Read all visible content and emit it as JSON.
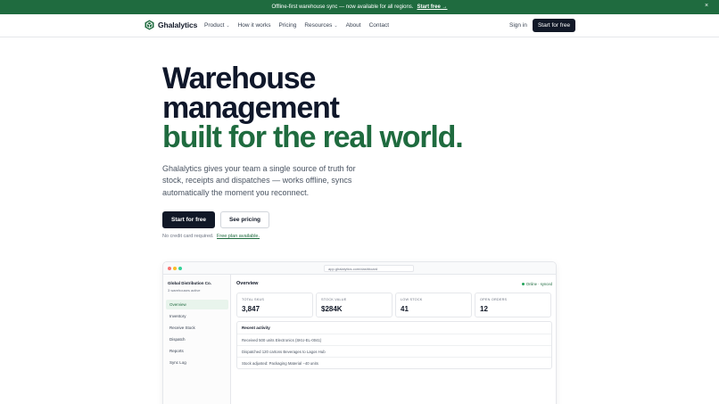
{
  "announcement": {
    "text": "Offline-first warehouse sync — now available for all regions.",
    "cta": "Start free →",
    "close": "×"
  },
  "nav": {
    "brand": "Ghalalytics",
    "links": [
      {
        "label": "Product",
        "dropdown": true
      },
      {
        "label": "How it works",
        "dropdown": false
      },
      {
        "label": "Pricing",
        "dropdown": false
      },
      {
        "label": "Resources",
        "dropdown": true
      },
      {
        "label": "About",
        "dropdown": false
      },
      {
        "label": "Contact",
        "dropdown": false
      }
    ],
    "signin": "Sign in",
    "cta": "Start for free"
  },
  "hero": {
    "title_line1": "Warehouse",
    "title_line2": "management",
    "title_line3": "built for the real world.",
    "subtitle": "Ghalalytics gives your team a single source of truth for stock, receipts and dispatches — works offline, syncs automatically the moment you reconnect.",
    "primary_cta": "Start for free",
    "secondary_cta": "See pricing",
    "note": "No credit card required.",
    "note_link": "Free plan available."
  },
  "mockup": {
    "url": "app.ghalalytics.com/dashboard",
    "org_name": "Global Distribution Co.",
    "org_sub": "3 warehouses active",
    "sidebar": [
      "Overview",
      "Inventory",
      "Receive Stock",
      "Dispatch",
      "Reports",
      "Sync Log"
    ],
    "active_item": "Overview",
    "title": "Overview",
    "status": "Online · synced",
    "stats": [
      {
        "label": "TOTAL SKUS",
        "value": "3,847"
      },
      {
        "label": "STOCK VALUE",
        "value": "$284K"
      },
      {
        "label": "LOW STOCK",
        "value": "41"
      },
      {
        "label": "OPEN ORDERS",
        "value": "12"
      }
    ],
    "activity_title": "Recent activity",
    "activity": [
      "Received 500 units Electronics (SKU-EL-0041)",
      "Dispatched 120 cartons Beverages to Lagos Hub",
      "Stock adjusted: Packaging Material −40 units"
    ]
  },
  "colors": {
    "brand_green": "#1f6b3f",
    "dark": "#111827",
    "muted": "#6b7280"
  }
}
